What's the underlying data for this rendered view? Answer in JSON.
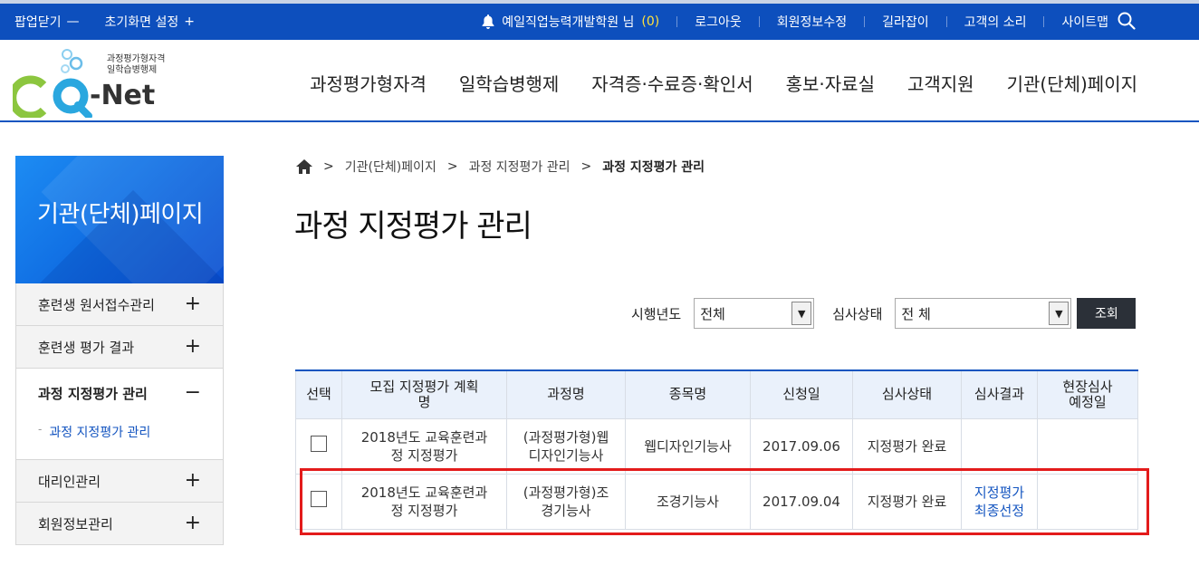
{
  "topbar": {
    "popup_close": "팝업닫기",
    "reset_screen": "초기화면 설정",
    "user_name": "예일직업능력개발학원 님",
    "count": "(0)",
    "logout": "로그아웃",
    "edit_member": "회원정보수정",
    "guide": "길라잡이",
    "voice": "고객의 소리",
    "sitemap": "사이트맵"
  },
  "logo": {
    "caption_line1": "과정평가형자격",
    "caption_line2": "일학습병행제",
    "brand": "CQ-Net"
  },
  "gnb": {
    "items": [
      "과정평가형자격",
      "일학습병행제",
      "자격증·수료증·확인서",
      "홍보·자료실",
      "고객지원",
      "기관(단체)페이지"
    ]
  },
  "sidebar": {
    "title": "기관(단체)페이지",
    "items": [
      {
        "label": "훈련생 원서접수관리",
        "toggle": "+"
      },
      {
        "label": "훈련생 평가 결과",
        "toggle": "+"
      },
      {
        "label": "과정 지정평가 관리",
        "toggle": "−"
      },
      {
        "label": "대리인관리",
        "toggle": "+"
      },
      {
        "label": "회원정보관리",
        "toggle": "+"
      }
    ],
    "sub_items": [
      "과정 지정평가 관리"
    ],
    "sub_dash": "-"
  },
  "breadcrumb": [
    "기관(단체)페이지",
    "과정 지정평가 관리",
    "과정 지정평가 관리"
  ],
  "page_title": "과정 지정평가 관리",
  "filters": {
    "year_label": "시행년도",
    "year_value": "전체",
    "status_label": "심사상태",
    "status_value": "전 체",
    "search_button": "조회"
  },
  "table": {
    "headers": [
      "선택",
      "모집 지정평가 계획명",
      "과정명",
      "종목명",
      "신청일",
      "심사상태",
      "심사결과",
      "현장심사 예정일"
    ],
    "rows": [
      {
        "plan": "2018년도 교육훈련과정 지정평가",
        "course": "(과정평가형)웹디자인기능사",
        "item": "웹디자인기능사",
        "date": "2017.09.06",
        "status": "지정평가 완료",
        "result": "",
        "onsite": ""
      },
      {
        "plan": "2018년도 교육훈련과정 지정평가",
        "course": "(과정평가형)조경기능사",
        "item": "조경기능사",
        "date": "2017.09.04",
        "status": "지정평가 완료",
        "result": "지정평가 최종선정",
        "onsite": ""
      }
    ]
  },
  "colors": {
    "primary": "#0d4fbd",
    "highlight": "#e31b1b",
    "header_bg": "#eaf1fb"
  }
}
